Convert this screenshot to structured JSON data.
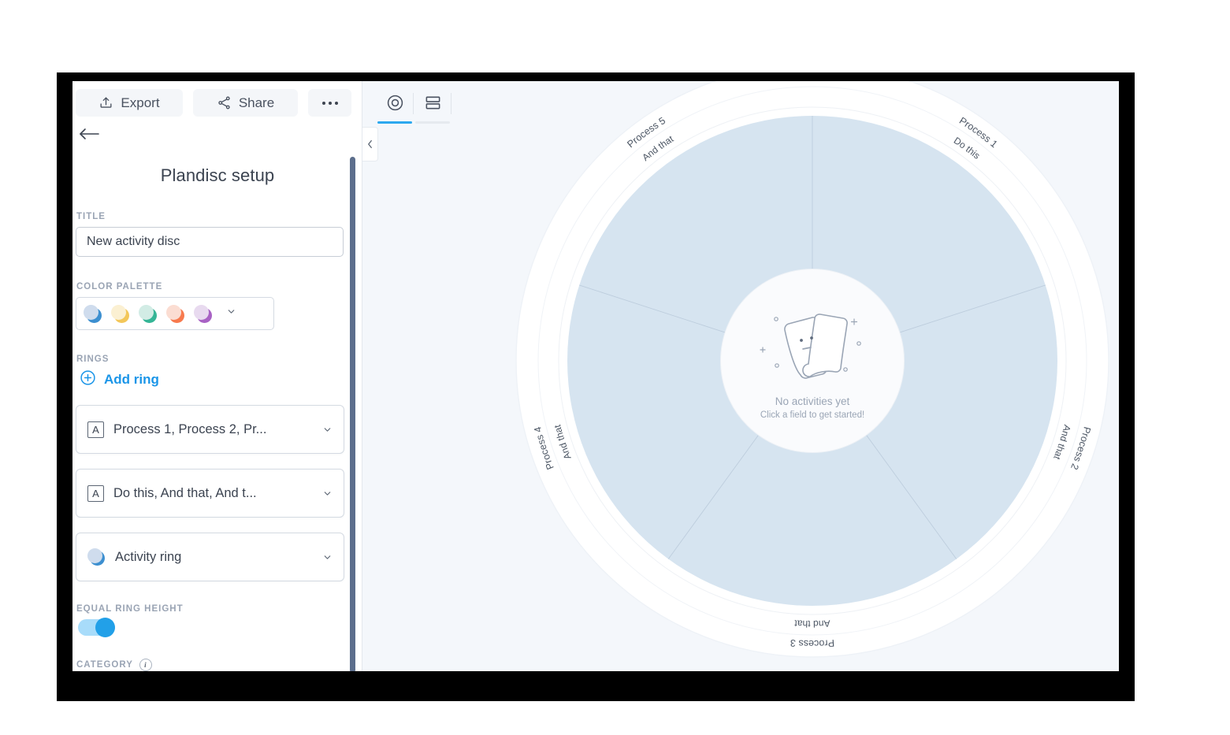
{
  "toolbar": {
    "export_label": "Export",
    "share_label": "Share",
    "more_label": "···"
  },
  "panel": {
    "title": "Plandisc setup",
    "back_icon": "back-arrow-icon"
  },
  "title_field": {
    "label": "TITLE",
    "value": "New activity disc",
    "placeholder": "New activity disc"
  },
  "palette": {
    "label": "COLOR PALETTE",
    "swatches": [
      {
        "name": "blue",
        "front": "#cfdced",
        "back": "#3c8fd0"
      },
      {
        "name": "yellow",
        "front": "#fbf0d2",
        "back": "#f3c75a"
      },
      {
        "name": "green",
        "front": "#d2ece5",
        "back": "#35b596"
      },
      {
        "name": "coral",
        "front": "#fbddd2",
        "back": "#f77a4e"
      },
      {
        "name": "purple",
        "front": "#e8daef",
        "back": "#a862c4"
      }
    ]
  },
  "rings": {
    "label": "RINGS",
    "add_label": "Add ring",
    "items": [
      {
        "glyph": "A",
        "type": "text",
        "label": "Process 1, Process 2, Pr..."
      },
      {
        "glyph": "A",
        "type": "text",
        "label": "Do this, And that, And t..."
      },
      {
        "glyph": "dot",
        "type": "activity",
        "label": "Activity ring"
      }
    ]
  },
  "equal_ring_height": {
    "label": "EQUAL RING HEIGHT",
    "value": "on"
  },
  "category": {
    "label": "CATEGORY",
    "info_glyph": "i",
    "value": ""
  },
  "view_tabs": [
    {
      "name": "disc-view",
      "icon": "circle-target-icon",
      "active": true
    },
    {
      "name": "list-view",
      "icon": "rows-icon",
      "active": false
    }
  ],
  "disc": {
    "outer_ring_labels": [
      "Process 1",
      "Process 2",
      "Process 3",
      "Process 4",
      "Process 5"
    ],
    "inner_ring_labels": [
      "Do this",
      "And that",
      "And that",
      "And that",
      "And that"
    ],
    "sector_count": 5,
    "fill_color": "#d6e4f0",
    "band_color": "#ffffff",
    "empty_state": {
      "title": "No activities yet",
      "subtitle": "Click a field to get started!",
      "illustration": "two-cards-icon"
    }
  }
}
